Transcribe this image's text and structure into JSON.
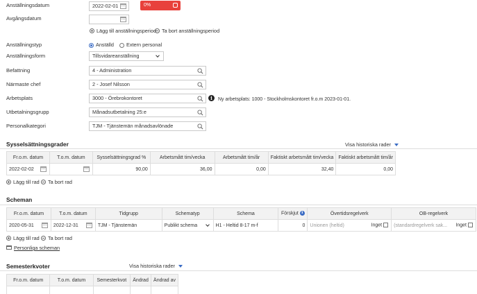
{
  "employment": {
    "anstallningsdatum_label": "Anställningsdatum",
    "anstallningsdatum_value": "2022-02-01",
    "progress_text": "0%",
    "progress_fraction": 0.0,
    "progress_color": "#e8413c",
    "avgangsdatum_label": "Avgångsdatum",
    "avgangsdatum_value": "",
    "add_period": "Lägg till anställningsperiod",
    "remove_period": "Ta bort anställningsperiod",
    "typ_label": "Anställningstyp",
    "typ_options": [
      "Anställd",
      "Extern personal"
    ],
    "typ_selected": "Anställd",
    "form_label": "Anställningsform",
    "form_value": "Tillsvidareanställning",
    "befattning_label": "Befattning",
    "befattning_value": "4 - Administration",
    "chef_label": "Närmaste chef",
    "chef_value": "2 - Josef Nilsson",
    "arbetsplats_label": "Arbetsplats",
    "arbetsplats_value": "3000 - Örebrokontoret",
    "arbetsplats_info": "Ny arbetsplats: 1000 - Stockholmskontoret fr.o.m 2023-01-01.",
    "utbetalning_label": "Utbetalningsgrupp",
    "utbetalning_value": "Månadsutbetalning 25:e",
    "personal_label": "Personalkategori",
    "personal_value": "TJM - Tjänstemän månadsavlönade"
  },
  "syssel": {
    "title": "Sysselsättningsgrader",
    "history": "Visa historiska rader",
    "headers": [
      "Fr.o.m. datum",
      "T.o.m. datum",
      "Sysselsättningsgrad %",
      "Arbetsmått tim/vecka",
      "Arbetsmått tim/år",
      "Faktiskt arbetsmått tim/vecka",
      "Faktiskt arbetsmått tim/år"
    ],
    "row": [
      "2022-02-02",
      "",
      "90,00",
      "36,00",
      "0,00",
      "32,40",
      "0,00"
    ],
    "add_row": "Lägg till rad",
    "remove_row": "Ta bort rad"
  },
  "scheman": {
    "title": "Scheman",
    "headers": [
      "Fr.o.m. datum",
      "T.o.m. datum",
      "Tidgrupp",
      "Schematyp",
      "Schema",
      "Förskjut",
      "Övertidsregelverk",
      "OB-regelverk"
    ],
    "row": {
      "from": "2020-05-31",
      "to": "2022-12-31",
      "tidgrupp": "TJM - Tjänstemän",
      "schematyp": "Publikt schema",
      "schema": "H1 - Heltid 8-17 m-f",
      "forskjut": "0",
      "overtid": "Unionen (heltid)",
      "overtid_check": "Inget",
      "ob": "(standardregelverk sak...",
      "ob_check": "Inget"
    },
    "add_row": "Lägg till rad",
    "remove_row": "Ta bort rad",
    "personal_link": "Personliga scheman"
  },
  "semester": {
    "title": "Semesterkvoter",
    "history": "Visa historiska rader",
    "headers": [
      "Fr.o.m. datum",
      "T.o.m. datum",
      "Semesterkvot",
      "Ändrad",
      "Ändrad av"
    ]
  }
}
